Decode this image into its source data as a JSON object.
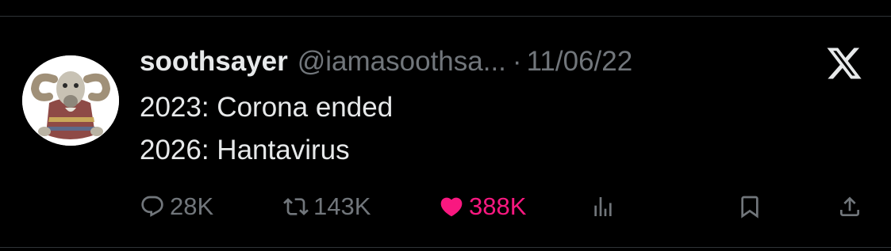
{
  "tweet": {
    "author_name": "soothsayer",
    "author_handle": "@iamasoothsa...",
    "separator": "·",
    "date": "11/06/22",
    "lines": [
      "2023: Corona ended",
      "2026: Hantavirus"
    ]
  },
  "actions": {
    "replies": "28K",
    "reposts": "143K",
    "likes": "388K"
  },
  "icons": {
    "reply": "reply-icon",
    "repost": "repost-icon",
    "like": "heart-icon",
    "views": "analytics-icon",
    "bookmark": "bookmark-icon",
    "share": "share-icon",
    "brand": "x-logo"
  },
  "colors": {
    "background": "#000000",
    "text": "#e7e9ea",
    "muted": "#71767b",
    "like": "#f91880"
  }
}
